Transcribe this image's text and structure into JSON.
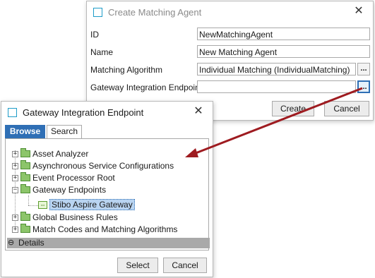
{
  "create_dialog": {
    "title": "Create Matching Agent",
    "id_label": "ID",
    "id_value": "NewMatchingAgent",
    "name_label": "Name",
    "name_value": "New Matching Agent",
    "algorithm_label": "Matching Algorithm",
    "algorithm_value": "Individual Matching (IndividualMatching)",
    "gateway_label": "Gateway Integration Endpoint",
    "gateway_value": "",
    "browse_button": "...",
    "create_label": "Create",
    "cancel_label": "Cancel"
  },
  "gateway_dialog": {
    "title": "Gateway Integration Endpoint",
    "tabs": [
      "Browse",
      "Search"
    ],
    "active_tab": "Browse",
    "tree": [
      {
        "label": "Asset Analyzer",
        "expanded": false
      },
      {
        "label": "Asynchronous Service Configurations",
        "expanded": false
      },
      {
        "label": "Event Processor Root",
        "expanded": false
      },
      {
        "label": "Gateway Endpoints",
        "expanded": true
      },
      {
        "label": "Stibo Aspire Gateway",
        "selected": true
      },
      {
        "label": "Global Business Rules",
        "expanded": false
      },
      {
        "label": "Match Codes and Matching Algorithms",
        "expanded": false
      }
    ],
    "details_label": "Details",
    "select_label": "Select",
    "cancel_label": "Cancel"
  },
  "colors": {
    "accent": "#1e9cc8",
    "arrow": "#9e1b20",
    "tab_active": "#2f6fb5",
    "selection": "#b9d4f1",
    "details_bar": "#a9a9a9"
  }
}
